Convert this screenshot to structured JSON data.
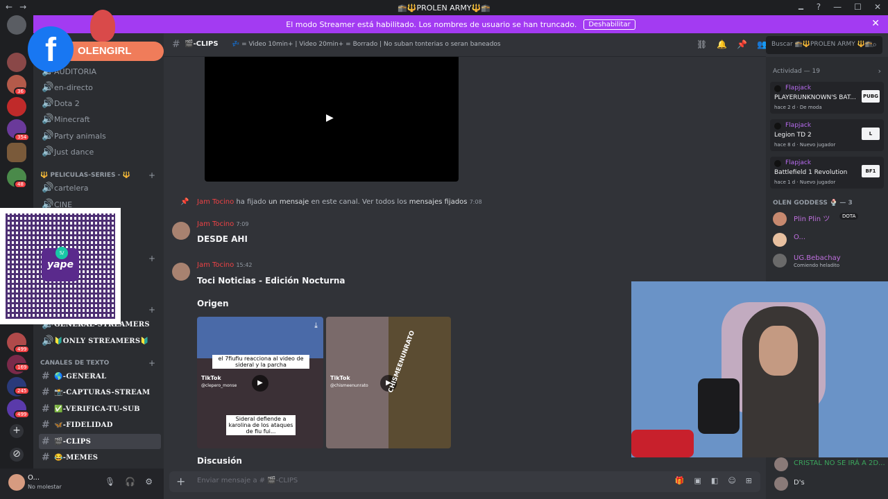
{
  "window": {
    "title": "🕋🔱PROLEN ARMY🔱🕋",
    "nav_back": "←",
    "nav_forward": "→",
    "controls": [
      "🗕",
      "?",
      "—",
      "☐",
      "✕"
    ]
  },
  "banner": {
    "text": "El modo Streamer está habilitado. Los nombres de usuario se han truncado.",
    "button": "Deshabilitar",
    "close": "✕"
  },
  "guilds": {
    "badges": [
      "36",
      "354",
      "48",
      "499",
      "169",
      "245",
      "499"
    ],
    "add": "+",
    "explore": "⊘"
  },
  "channels": {
    "items_top": [
      "AUDITORIA",
      "en-directo",
      "Dota 2",
      "Minecraft",
      "Party animals",
      "Just dance"
    ],
    "category_movies": "🔱 PELICULAS-SERIES - 🔱",
    "movies_items": [
      "cartelera",
      "CINE"
    ],
    "general_streamers": "GENERAL-STREAMERS",
    "only_streamers": "🔰ONLY STREAMERS🔰",
    "category_text": "CANALES DE TEXTO",
    "text_items": [
      "🌎-GENERAL",
      "📸-CAPTURAS-STREAM",
      "✅-VERIFICA-TU-SUB",
      "🦋-FIDELIDAD",
      "🎬-CLIPS",
      "😂-MEMES"
    ]
  },
  "user_panel": {
    "name": "O...",
    "status": "No molestar"
  },
  "header": {
    "channel": "🎬-CLIPS",
    "topic": "💤 = Video 10min+ | Video 20min+ = Borrado | No suban tonterias o seran baneados",
    "search_placeholder": "Buscar 🕋🔱PROLEN ARMY 🔱🕋"
  },
  "messages": {
    "pin_user": "Jam Tocino",
    "pin_text1": "ha fijado",
    "pin_link1": "un mensaje",
    "pin_text2": "en este canal. Ver todos los",
    "pin_link2": "mensajes fijados",
    "pin_time": "7:08",
    "msg1_user": "Jam Tocino",
    "msg1_time": "7:09",
    "msg1_text": "DESDE AHI",
    "msg2_user": "Jam Tocino",
    "msg2_time": "15:42",
    "msg2_text": "Toci Noticias - Edición Nocturna",
    "heading_origen": "Origen",
    "heading_discusion": "Discusión",
    "thumb1_caption_top": "el 7fiufiu reacciona al video de sideral y la parcha",
    "thumb1_caption_bottom": "Sideral defiende a karolina de los ataques de fiu fui...",
    "tiktok_label": "TikTok",
    "tiktok_user1": "@clepero_monse",
    "tiktok_user2": "@chismeenunrato",
    "thumb2_watermark": "CHISMEENUNRATO"
  },
  "composer": {
    "placeholder": "Enviar mensaje a # 🎬-CLIPS"
  },
  "members": {
    "activity_header": "Actividad — 19",
    "activities": [
      {
        "user": "Flapjack",
        "game": "PLAYERUNKNOWN'S BAT...",
        "meta": "hace 2 d · De moda",
        "icon": "PUBG"
      },
      {
        "user": "Flapjack",
        "game": "Legion TD 2",
        "meta": "hace 8 d · Nuevo jugador",
        "icon": "L"
      },
      {
        "user": "Flapjack",
        "game": "Battlefield 1 Revolution",
        "meta": "hace 1 d · Nuevo jugador",
        "icon": "BF1"
      }
    ],
    "group_header": "OLEN GODDESS 🍨 — 3",
    "group_members": [
      {
        "name": "Plin Plin ツ",
        "badge": "DOTA",
        "sub": ""
      },
      {
        "name": "O...",
        "badge": "",
        "sub": ""
      },
      {
        "name": "UG.Bebachay",
        "badge": "",
        "sub": "Comiendo heladito"
      }
    ],
    "bottom_members": [
      {
        "name": "CRISTAL NO SE IRÁ A 2D..."
      },
      {
        "name": "D's"
      }
    ]
  },
  "overlay": {
    "fb_glyph": "f",
    "name": "OLENGIRL",
    "yape": "yape",
    "yape_badge": "S/"
  },
  "colors": {
    "accent": "#a33bf2",
    "red_name": "#ed4245",
    "purple_name": "#c070e0",
    "facebook": "#1877f2"
  }
}
